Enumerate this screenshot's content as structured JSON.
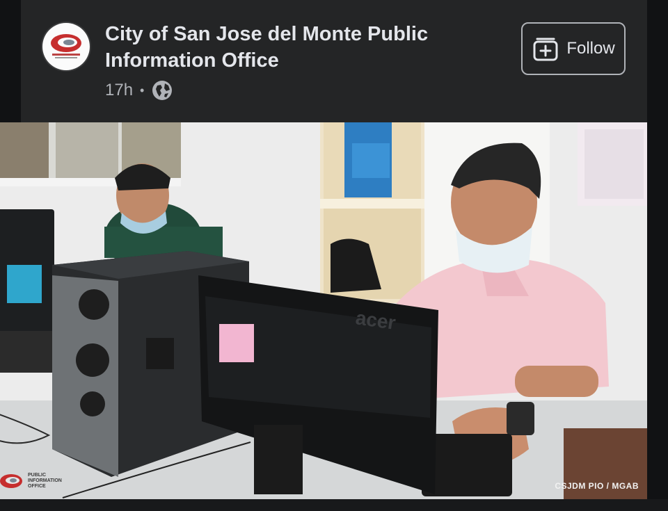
{
  "post": {
    "page_name": "City of San Jose del Monte Public Information Office",
    "time": "17h",
    "separator": "•",
    "privacy_icon": "globe-icon",
    "follow_label": "Follow",
    "follow_icon": "add-page-icon"
  },
  "photo": {
    "monitor_brand": "acer",
    "watermark_lines": [
      "PUBLIC",
      "INFORMATION",
      "OFFICE"
    ],
    "credit": "CSJDM PIO / MGAB"
  },
  "colors": {
    "background": "#242526",
    "text_primary": "#e4e6eb",
    "text_secondary": "#b0b3b8"
  }
}
